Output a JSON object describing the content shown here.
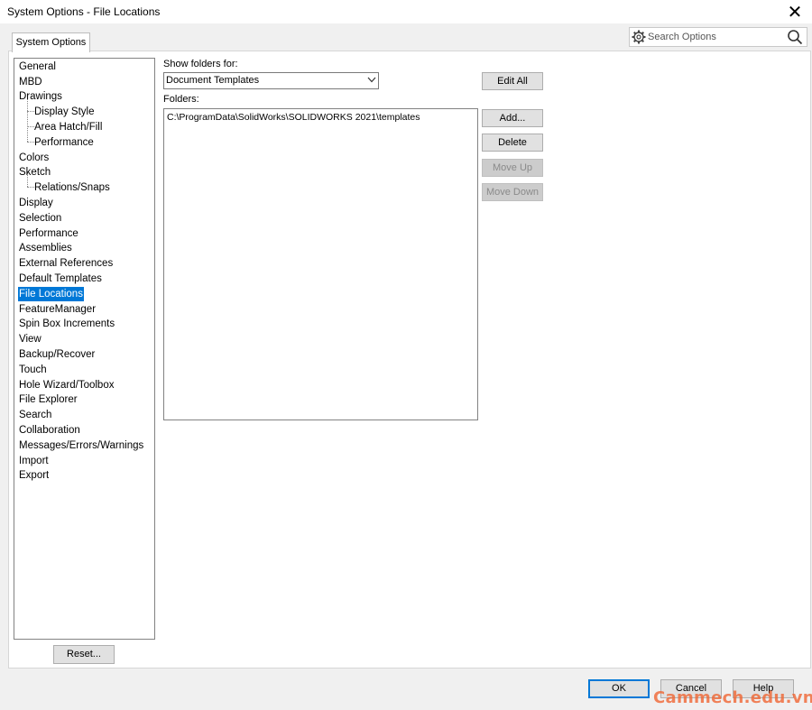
{
  "window": {
    "title": "System Options - File Locations"
  },
  "tab": {
    "label": "System Options"
  },
  "search": {
    "placeholder": "Search Options"
  },
  "tree": {
    "items": [
      {
        "label": "General"
      },
      {
        "label": "MBD"
      },
      {
        "label": "Drawings"
      },
      {
        "label": "Display Style"
      },
      {
        "label": "Area Hatch/Fill"
      },
      {
        "label": "Performance"
      },
      {
        "label": "Colors"
      },
      {
        "label": "Sketch"
      },
      {
        "label": "Relations/Snaps"
      },
      {
        "label": "Display"
      },
      {
        "label": "Selection"
      },
      {
        "label": "Performance"
      },
      {
        "label": "Assemblies"
      },
      {
        "label": "External References"
      },
      {
        "label": "Default Templates"
      },
      {
        "label": "File Locations"
      },
      {
        "label": "FeatureManager"
      },
      {
        "label": "Spin Box Increments"
      },
      {
        "label": "View"
      },
      {
        "label": "Backup/Recover"
      },
      {
        "label": "Touch"
      },
      {
        "label": "Hole Wizard/Toolbox"
      },
      {
        "label": "File Explorer"
      },
      {
        "label": "Search"
      },
      {
        "label": "Collaboration"
      },
      {
        "label": "Messages/Errors/Warnings"
      },
      {
        "label": "Import"
      },
      {
        "label": "Export"
      }
    ],
    "selected": "File Locations"
  },
  "content": {
    "show_folders_label": "Show folders for:",
    "show_folders_value": "Document Templates",
    "folders_label": "Folders:",
    "folders": [
      "C:\\ProgramData\\SolidWorks\\SOLIDWORKS 2021\\templates"
    ]
  },
  "buttons": {
    "edit_all": "Edit All",
    "add": "Add...",
    "delete": "Delete",
    "move_up": "Move Up",
    "move_down": "Move Down",
    "reset": "Reset...",
    "ok": "OK",
    "cancel": "Cancel",
    "help": "Help"
  },
  "watermark": {
    "text": "Cammech.edu.vn"
  },
  "colors": {
    "selection": "#0078d7",
    "watermark": "#f0632f"
  }
}
